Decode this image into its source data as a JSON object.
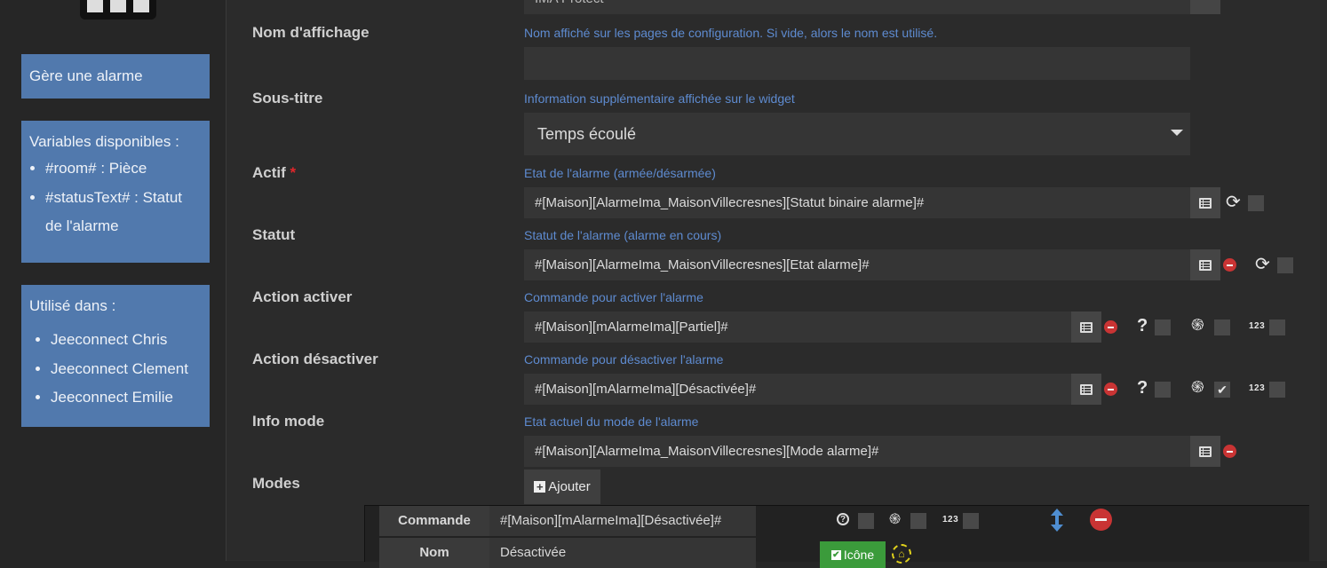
{
  "sidebar": {
    "description": "Gère une alarme",
    "variables_title": "Variables disponibles :",
    "variables": [
      "#room# : Pièce",
      "#statusText# : Statut de l'alarme"
    ],
    "used_in_title": "Utilisé dans :",
    "used_in": [
      "Jeeconnect Chris",
      "Jeeconnect Clement",
      "Jeeconnect Emilie"
    ]
  },
  "form": {
    "top_value": "IMA Protect",
    "display_name": {
      "label": "Nom d'affichage",
      "help": "Nom affiché sur les pages de configuration. Si vide, alors le nom est utilisé.",
      "value": ""
    },
    "subtitle": {
      "label": "Sous-titre",
      "help": "Information supplémentaire affichée sur le widget",
      "value": "Temps écoulé"
    },
    "active": {
      "label": "Actif",
      "required_mark": "*",
      "help": "Etat de l'alarme (armée/désarmée)",
      "value": "#[Maison][AlarmeIma_MaisonVillecresnes][Statut binaire alarme]#"
    },
    "status": {
      "label": "Statut",
      "help": "Statut de l'alarme (alarme en cours)",
      "value": "#[Maison][AlarmeIma_MaisonVillecresnes][Etat alarme]#"
    },
    "action_on": {
      "label": "Action activer",
      "help": "Commande pour activer l'alarme",
      "value": "#[Maison][mAlarmeIma][Partiel]#"
    },
    "action_off": {
      "label": "Action désactiver",
      "help": "Commande pour désactiver l'alarme",
      "value": "#[Maison][mAlarmeIma][Désactivée]#"
    },
    "info_mode": {
      "label": "Info mode",
      "help": "Etat actuel du mode de l'alarme",
      "value": "#[Maison][AlarmeIma_MaisonVillecresnes][Mode alarme]#"
    },
    "modes": {
      "label": "Modes",
      "add_button": "Ajouter"
    }
  },
  "icons": {
    "confirm": "?",
    "code": "123",
    "fingerprint": "fingerprint-icon",
    "refresh": "refresh-icon",
    "list": "list-icon"
  },
  "flags": {
    "action_off_fingerprint_checked": true
  },
  "mode_row": {
    "command_label": "Commande",
    "command_value": "#[Maison][mAlarmeIma][Désactivée]#",
    "name_label": "Nom",
    "name_value": "Désactivée",
    "icon_button": "Icône"
  },
  "colors": {
    "accent_blue": "#5179ad",
    "help_text": "#5e8bd0",
    "danger": "#c93434",
    "success": "#3b9b3b",
    "required": "#e0262b"
  }
}
